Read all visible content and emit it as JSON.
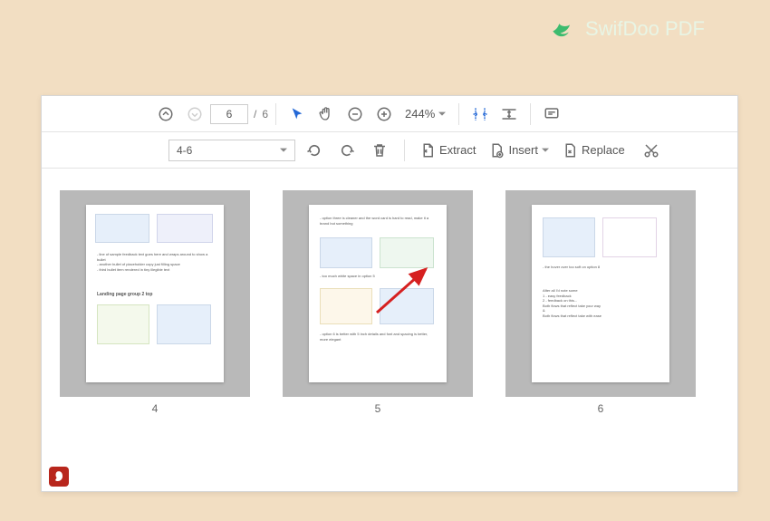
{
  "brand": {
    "name": "SwifDoo PDF"
  },
  "toolbar": {
    "current_page": "6",
    "total_pages": "6",
    "page_separator": "/",
    "zoom": "244%"
  },
  "page_toolbar": {
    "range_selected": "4-6",
    "extract_label": "Extract",
    "insert_label": "Insert",
    "replace_label": "Replace"
  },
  "thumbnails": {
    "pages": [
      "4",
      "5",
      "6"
    ]
  }
}
